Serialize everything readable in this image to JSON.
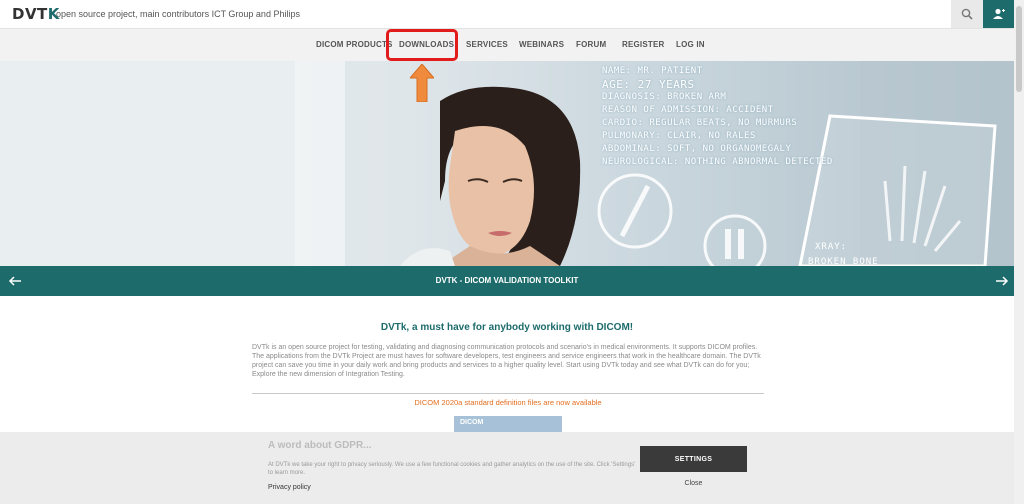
{
  "header": {
    "logo": {
      "main": "DVT",
      "accent": "K"
    },
    "tagline": "open source project, main contributors ICT Group and Philips"
  },
  "nav": {
    "items": [
      "DICOM PRODUCTS",
      "DOWNLOADS",
      "SERVICES",
      "WEBINARS",
      "FORUM",
      "REGISTER",
      "LOG IN"
    ],
    "highlighted": "DOWNLOADS"
  },
  "hero": {
    "lines": [
      "NAME: MR. PATIENT",
      "AGE: 27 YEARS",
      "DIAGNOSIS: BROKEN ARM",
      "REASON OF ADMISSION: ACCIDENT",
      "CARDIO: REGULAR BEATS, NO MURMURS",
      "PULMONARY: CLAIR, NO RALES",
      "ABDOMINAL: SOFT, NO ORGANOMEGALY",
      "NEUROLOGICAL: NOTHING ABNORMAL DETECTED"
    ],
    "xray_label": "XRAY:",
    "xray_sub": "BROKEN BONE"
  },
  "banner": {
    "title": "DVTK - DICOM VALIDATION TOOLKIT"
  },
  "content": {
    "title": "DVTk, a must have for anybody working with DICOM!",
    "body": "DVTk is an open source project for testing, validating and diagnosing communication protocols and scenario's in medical environments. It supports DICOM profiles. The applications from the DVTk Project are must haves for software developers, test engineers and service engineers that work in the healthcare domain. The DVTk project can save you time in your daily work and bring products and services to a higher quality level. Start using DVTk today and see what DVTk can do for you; Explore the new dimension of Integration Testing.",
    "dicom_link": "DICOM 2020a standard definition files are now available",
    "dicom_thumb": "DICOM"
  },
  "gdpr": {
    "title": "A word about GDPR...",
    "text": "At DVTk we take your right to privacy seriously. We use a few functional cookies and gather analytics on the use of the site. Click 'Settings' to learn more.",
    "privacy": "Privacy policy",
    "settings": "SETTINGS",
    "close": "Close"
  },
  "colors": {
    "teal": "#1d6b6b",
    "highlight": "#e21b1b",
    "orange": "#f08a3c"
  }
}
